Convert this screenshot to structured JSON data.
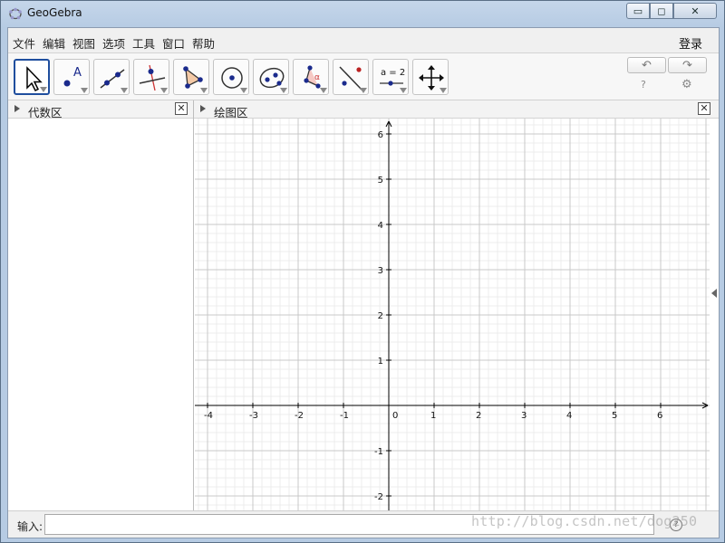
{
  "window": {
    "title": "GeoGebra",
    "min_symbol": "▭",
    "max_symbol": "◻",
    "close_symbol": "✕"
  },
  "menu": {
    "items": [
      "文件",
      "编辑",
      "视图",
      "选项",
      "工具",
      "窗口",
      "帮助"
    ],
    "login": "登录"
  },
  "toolbar": {
    "tools": [
      {
        "icon": "move-arrow-icon"
      },
      {
        "icon": "point-icon",
        "letter": "A"
      },
      {
        "icon": "line-icon"
      },
      {
        "icon": "perpendicular-line-icon"
      },
      {
        "icon": "polygon-icon"
      },
      {
        "icon": "circle-icon"
      },
      {
        "icon": "ellipse-icon"
      },
      {
        "icon": "angle-icon",
        "letter": "α"
      },
      {
        "icon": "reflect-icon"
      },
      {
        "icon": "slider-icon",
        "letter": "a = 2"
      },
      {
        "icon": "move-view-icon"
      }
    ],
    "undo_symbol": "↶",
    "redo_symbol": "↷",
    "help_symbol": "?",
    "settings_symbol": "⚙"
  },
  "algebra": {
    "title": "代数区",
    "close_symbol": "✕"
  },
  "graphics": {
    "title": "绘图区",
    "close_symbol": "✕",
    "x_ticks": [
      "-4",
      "-3",
      "-2",
      "-1",
      "0",
      "1",
      "2",
      "3",
      "4",
      "5",
      "6"
    ],
    "y_ticks": [
      "6",
      "5",
      "4",
      "3",
      "2",
      "1",
      "-1",
      "-2"
    ],
    "colors": {
      "major_grid": "#c8c8c8",
      "minor_grid": "#ececec",
      "axis": "#000000"
    }
  },
  "input": {
    "label": "输入:",
    "value": "",
    "help_symbol": "?"
  },
  "watermark": "http://blog.csdn.net/dog250"
}
